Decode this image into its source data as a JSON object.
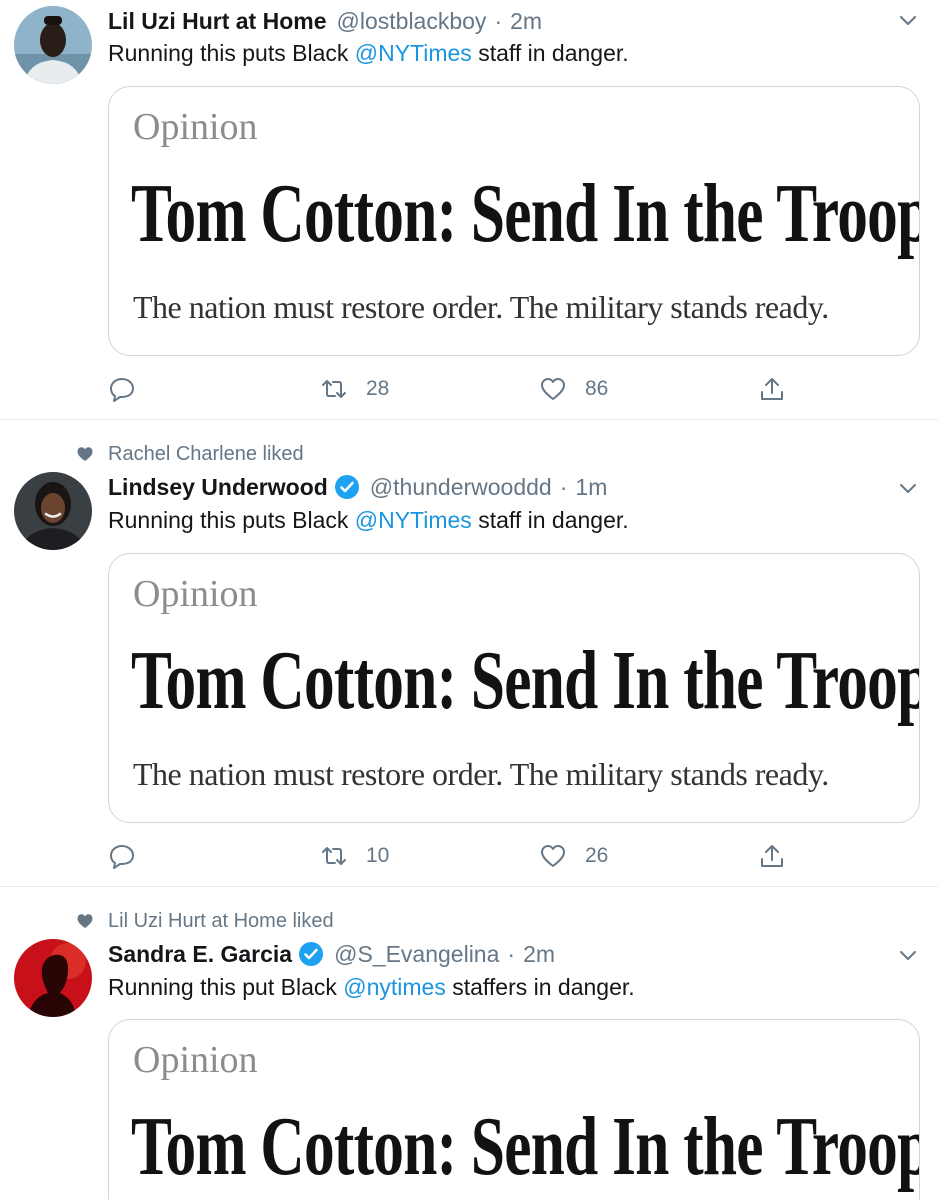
{
  "tweets": [
    {
      "social_context": "",
      "author_name": "Lil Uzi Hurt at Home",
      "verified": false,
      "handle": "@lostblackboy",
      "separator": "·",
      "time": "2m",
      "text_before": "Running this puts Black ",
      "mention": "@NYTimes",
      "text_after": " staff in danger.",
      "card": {
        "kicker": "Opinion",
        "headline": "Tom Cotton: Send In the Troops",
        "dek": "The nation must restore order. The military stands ready."
      },
      "retweet_count": "28",
      "like_count": "86"
    },
    {
      "social_context": "Rachel Charlene liked",
      "author_name": "Lindsey Underwood",
      "verified": true,
      "handle": "@thunderwooddd",
      "separator": "·",
      "time": "1m",
      "text_before": "Running this puts Black ",
      "mention": "@NYTimes",
      "text_after": " staff in danger.",
      "card": {
        "kicker": "Opinion",
        "headline": "Tom Cotton: Send In the Troops",
        "dek": "The nation must restore order. The military stands ready."
      },
      "retweet_count": "10",
      "like_count": "26"
    },
    {
      "social_context": "Lil Uzi Hurt at Home liked",
      "author_name": "Sandra E. Garcia",
      "verified": true,
      "handle": "@S_Evangelina",
      "separator": "·",
      "time": "2m",
      "text_before": "Running this put Black ",
      "mention": "@nytimes",
      "text_after": " staffers in danger.",
      "card": {
        "kicker": "Opinion",
        "headline": "Tom Cotton: Send In the Troops",
        "dek": ""
      }
    }
  ],
  "colors": {
    "link": "#1b95e0",
    "secondary": "#657786",
    "border": "#e6ecf0",
    "verified": "#1da1f2"
  }
}
